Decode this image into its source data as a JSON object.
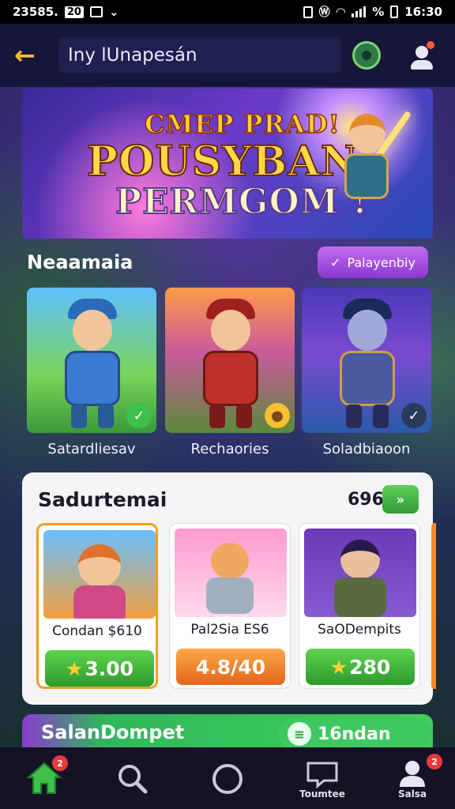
{
  "status_bar": {
    "left_text": "23585.",
    "left_badge": "20",
    "right_text": "%",
    "time": "16:30"
  },
  "header": {
    "search_text": "Iny lUnapesán"
  },
  "banner": {
    "line1": "CMEP PRAD!",
    "line2": "POUSYBAN",
    "line3": "PERMGOM !"
  },
  "featured": {
    "title": "Neaamaia",
    "action_label": "Palayenbiy",
    "items": [
      {
        "label": "Satardliesav"
      },
      {
        "label": "Rechaories"
      },
      {
        "label": "Soladbiaoon"
      }
    ]
  },
  "sales": {
    "title": "Sadurtemai",
    "count": "696",
    "items": [
      {
        "name": "Condan $610",
        "price": "3.00"
      },
      {
        "name": "Pal2Sia ES6",
        "price": "4.8/40"
      },
      {
        "name": "SaODempits",
        "price": "280"
      }
    ]
  },
  "promo": {
    "title": "SalanDompet",
    "pill_label": "16ndan"
  },
  "nav": {
    "items": [
      {
        "name": "home",
        "badge": "2",
        "label": ""
      },
      {
        "name": "search",
        "label": ""
      },
      {
        "name": "circle",
        "label": ""
      },
      {
        "name": "messages",
        "label": "Toumtee"
      },
      {
        "name": "profile",
        "badge": "2",
        "label": "Salsa"
      }
    ]
  },
  "colors": {
    "accent_yellow": "#f5c032",
    "primary_green": "#3ec04a",
    "action_purple": "#a64ee0",
    "price_orange": "#f08a2a",
    "nav_bg": "#131325"
  }
}
